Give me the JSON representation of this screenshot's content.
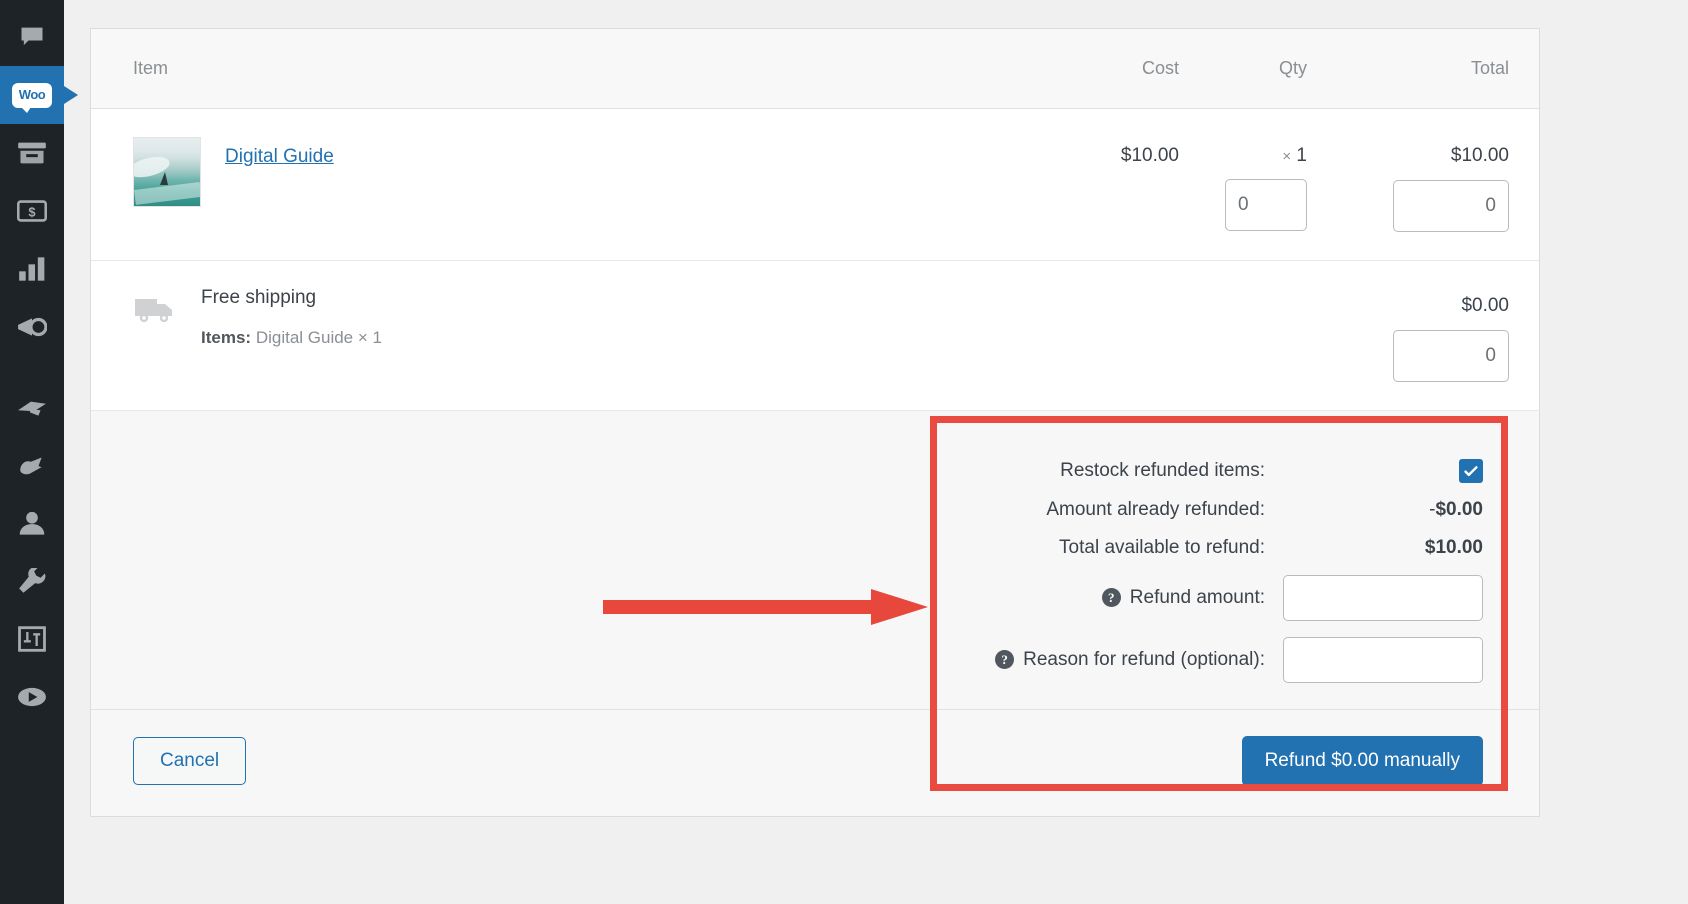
{
  "sidebar": {
    "items": [
      {
        "name": "comments",
        "icon": "comment-icon",
        "label": "Comments",
        "current": false
      },
      {
        "name": "woocommerce",
        "icon": "woo-logo-icon",
        "label": "WooCommerce",
        "badge_text": "Woo",
        "current": true
      },
      {
        "name": "products",
        "icon": "products-box-icon",
        "label": "Products",
        "current": false
      },
      {
        "name": "payments",
        "icon": "money-bill-icon",
        "label": "Payments",
        "current": false
      },
      {
        "name": "analytics",
        "icon": "bar-chart-icon",
        "label": "Analytics",
        "current": false
      },
      {
        "name": "marketing",
        "icon": "megaphone-icon",
        "label": "Marketing",
        "current": false
      },
      {
        "name": "appearance",
        "icon": "paintbrush-icon",
        "label": "Appearance",
        "current": false
      },
      {
        "name": "plugins",
        "icon": "plug-icon",
        "label": "Plugins",
        "current": false
      },
      {
        "name": "users",
        "icon": "user-icon",
        "label": "Users",
        "current": false
      },
      {
        "name": "tools",
        "icon": "wrench-icon",
        "label": "Tools",
        "current": false
      },
      {
        "name": "settings",
        "icon": "sliders-icon",
        "label": "Settings",
        "current": false
      },
      {
        "name": "media",
        "icon": "play-circle-icon",
        "label": "Media",
        "current": false
      }
    ]
  },
  "order_items": {
    "headers": {
      "item": "Item",
      "cost": "Cost",
      "qty": "Qty",
      "total": "Total"
    },
    "line_items": [
      {
        "name": "Digital Guide",
        "thumbnail_alt": "ocean wave product image",
        "cost": "$10.00",
        "qty_multiplier": "×",
        "qty": "1",
        "qty_refund_value": "0",
        "total": "$10.00",
        "total_refund_value": "0"
      }
    ],
    "shipping": {
      "icon": "truck-icon",
      "name": "Free shipping",
      "items_label": "Items:",
      "items_value": "Digital Guide × 1",
      "total": "$0.00",
      "total_refund_value": "0"
    }
  },
  "refund_panel": {
    "restock_label": "Restock refunded items:",
    "restock_checked": true,
    "already_refunded_label": "Amount already refunded:",
    "already_refunded_value_sign": "-",
    "already_refunded_value": "$0.00",
    "total_available_label": "Total available to refund:",
    "total_available_value": "$10.00",
    "refund_amount_label": "Refund amount:",
    "refund_amount_value": "",
    "refund_amount_help": "?",
    "reason_label": "Reason for refund (optional):",
    "reason_value": "",
    "reason_help": "?",
    "cancel_label": "Cancel",
    "refund_button_label": "Refund $0.00 manually"
  },
  "annotation": {
    "highlight_color": "#ea4b40",
    "arrow_color": "#e8483c",
    "shape": "arrow-pointing-right-at-refund-panel"
  },
  "colors": {
    "accent_blue": "#2271b1",
    "sidebar_bg": "#1d2327",
    "highlight_red": "#ea4b40"
  }
}
